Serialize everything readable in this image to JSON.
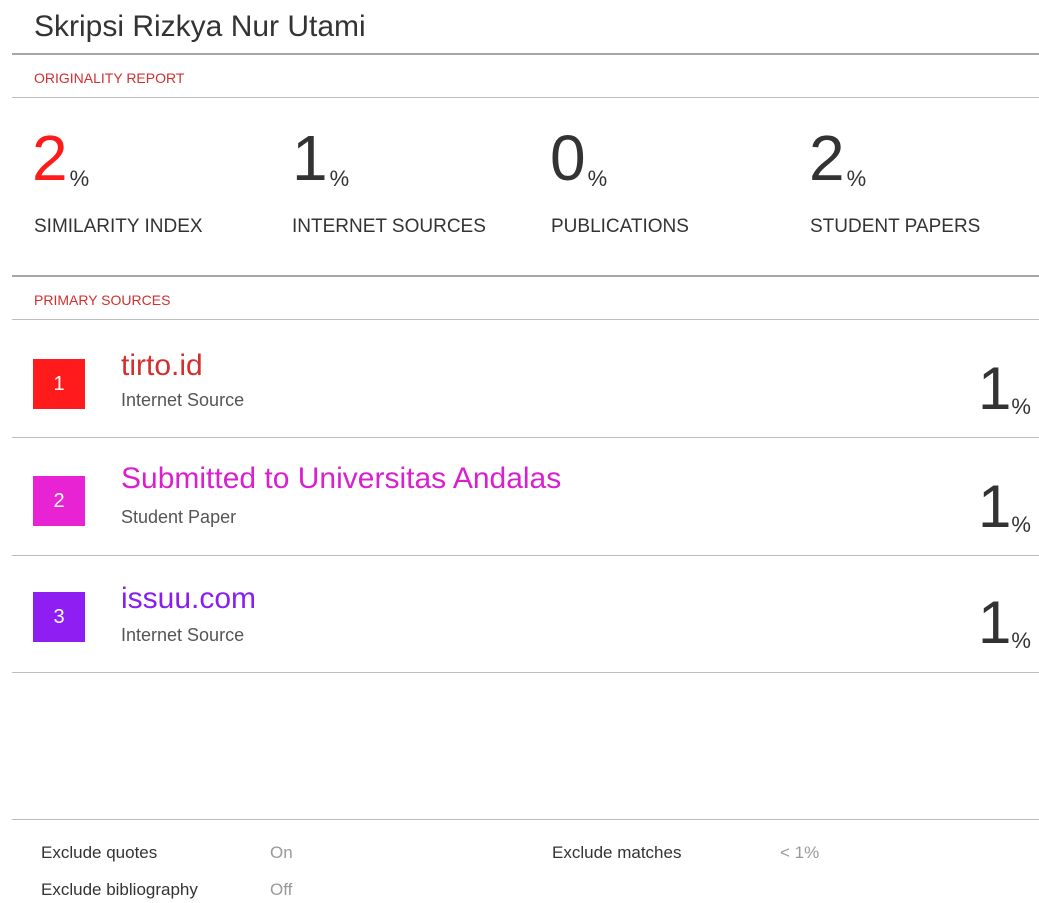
{
  "title": "Skripsi Rizkya Nur Utami",
  "originality": {
    "section_label": "ORIGINALITY REPORT",
    "stats": [
      {
        "value": "2",
        "unit": "%",
        "label": "SIMILARITY INDEX",
        "highlight": true
      },
      {
        "value": "1",
        "unit": "%",
        "label": "INTERNET SOURCES",
        "highlight": false
      },
      {
        "value": "0",
        "unit": "%",
        "label": "PUBLICATIONS",
        "highlight": false
      },
      {
        "value": "2",
        "unit": "%",
        "label": "STUDENT PAPERS",
        "highlight": false
      }
    ],
    "highlight_color": "#ff1b1b"
  },
  "primary_sources": {
    "section_label": "PRIMARY SOURCES",
    "items": [
      {
        "rank": "1",
        "name": "tirto.id",
        "type": "Internet Source",
        "percent": "1",
        "unit": "%",
        "color": "#ff1b1b",
        "name_color": "#d32f2f"
      },
      {
        "rank": "2",
        "name": "Submitted to Universitas Andalas",
        "type": "Student Paper",
        "percent": "1",
        "unit": "%",
        "color": "#e823d3",
        "name_color": "#d91fd0"
      },
      {
        "rank": "3",
        "name": "issuu.com",
        "type": "Internet Source",
        "percent": "1",
        "unit": "%",
        "color": "#8e1ef2",
        "name_color": "#8a1ef0"
      }
    ]
  },
  "footer": {
    "exclude_quotes_label": "Exclude quotes",
    "exclude_quotes_value": "On",
    "exclude_bibliography_label": "Exclude bibliography",
    "exclude_bibliography_value": "Off",
    "exclude_matches_label": "Exclude matches",
    "exclude_matches_value": "< 1%"
  }
}
